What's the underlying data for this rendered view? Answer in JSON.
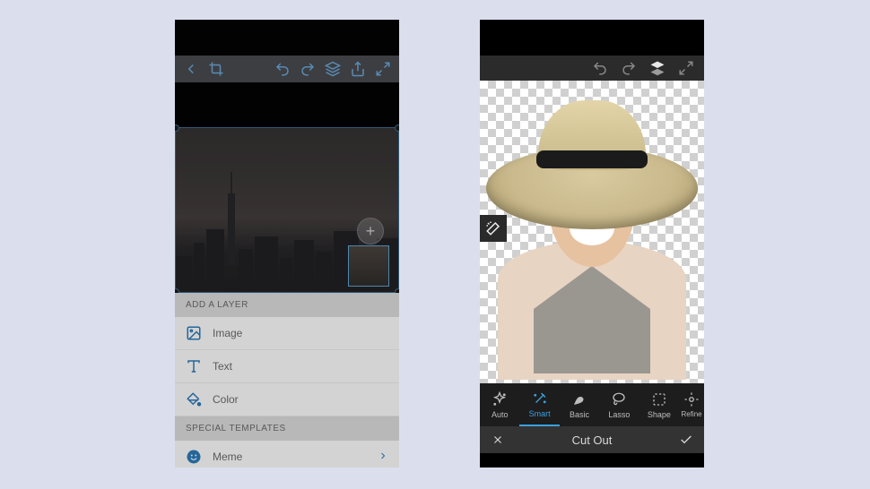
{
  "left": {
    "toolbar": {
      "back": "back-icon",
      "crop": "crop-icon",
      "undo": "undo-icon",
      "redo": "redo-icon",
      "layers": "layers-icon",
      "share": "share-icon",
      "fullscreen": "fullscreen-icon"
    },
    "addButton": "+",
    "panel": {
      "header1": "ADD A LAYER",
      "items": [
        {
          "label": "Image"
        },
        {
          "label": "Text"
        },
        {
          "label": "Color"
        }
      ],
      "header2": "SPECIAL TEMPLATES",
      "templates": [
        {
          "label": "Meme"
        }
      ]
    }
  },
  "right": {
    "toolbar": {
      "undo": "undo-icon",
      "redo": "redo-icon",
      "layers": "layers-icon",
      "fullscreen": "fullscreen-icon"
    },
    "wand": "magic-wand-icon",
    "tools": [
      {
        "label": "Auto",
        "active": false
      },
      {
        "label": "Smart",
        "active": true
      },
      {
        "label": "Basic",
        "active": false
      },
      {
        "label": "Lasso",
        "active": false
      },
      {
        "label": "Shape",
        "active": false
      },
      {
        "label": "Refine",
        "active": false
      }
    ],
    "action": {
      "title": "Cut Out"
    }
  }
}
